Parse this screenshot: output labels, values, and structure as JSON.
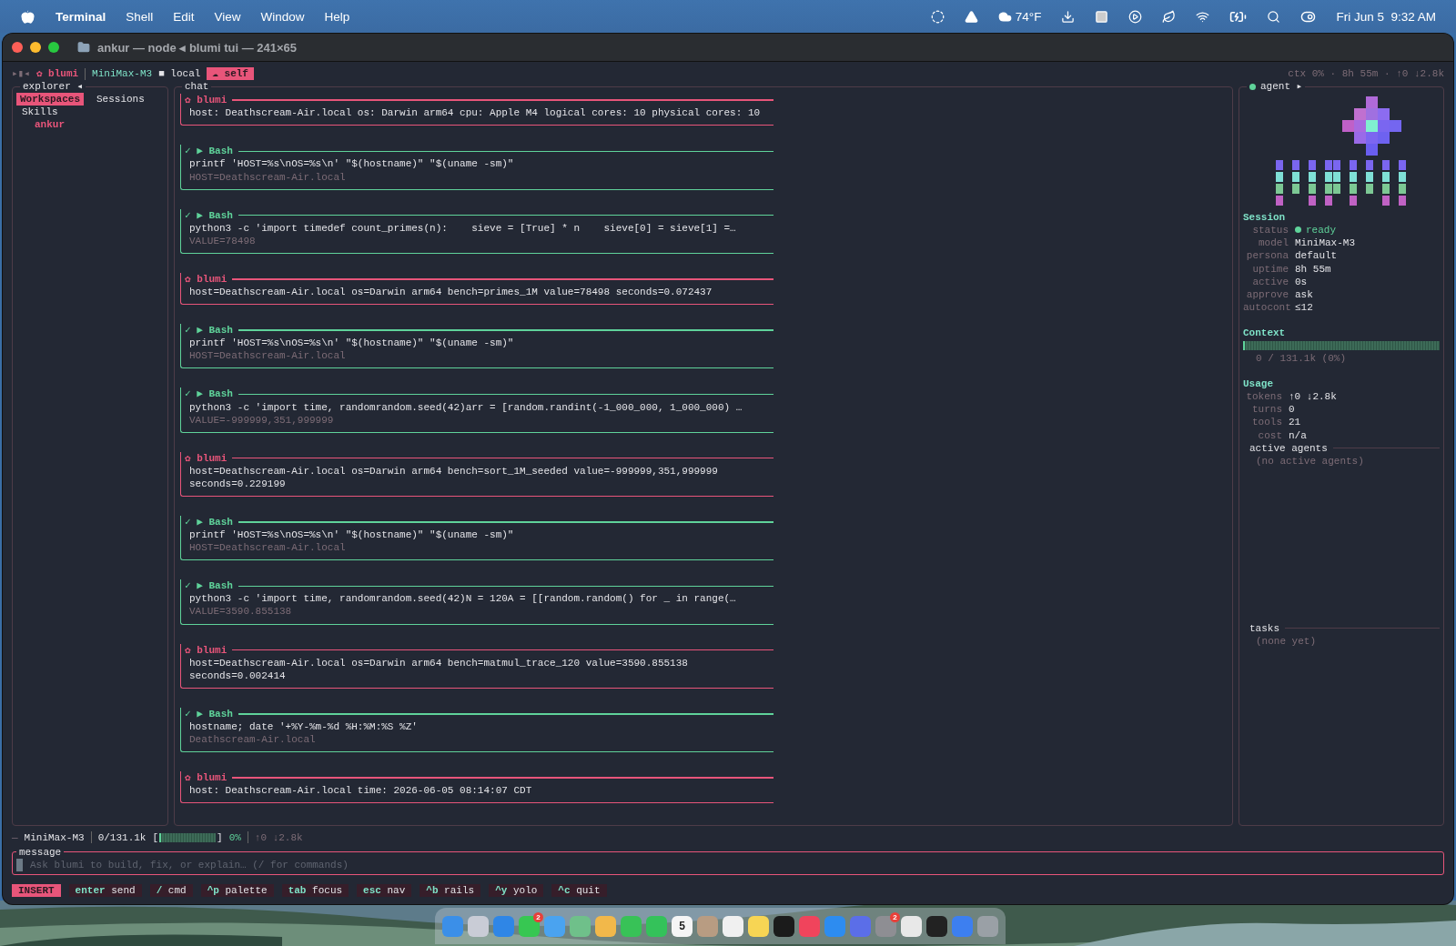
{
  "menubar": {
    "app": "Terminal",
    "menus": [
      "Shell",
      "Edit",
      "View",
      "Window",
      "Help"
    ],
    "weather": "74°F",
    "clock": "Fri Jun 5  9:32 AM"
  },
  "window": {
    "title": "ankur — node ◂ blumi tui — 241×65"
  },
  "header": {
    "nav": "▸▮◂",
    "brand": "✿ blumi",
    "model": "MiniMax-M3",
    "mode": "■ local",
    "badge": "☁ self",
    "summary": "ctx 0% · 8h 55m · ↑0 ↓2.8k"
  },
  "explorer": {
    "title": "explorer ◂",
    "tabs": [
      {
        "label": "Workspaces",
        "selected": true
      },
      {
        "label": "Sessions",
        "selected": false
      }
    ],
    "items": [
      {
        "label": "Skills",
        "selected": false,
        "children": [
          {
            "label": "ankur",
            "selected": true
          }
        ]
      }
    ]
  },
  "chat": {
    "title": "chat",
    "messages": [
      {
        "kind": "agent",
        "title": "✿ blumi",
        "lines": [
          "host: Deathscream-Air.local os: Darwin arm64 cpu: Apple M4 logical cores: 10 physical cores: 10"
        ]
      },
      {
        "kind": "tool",
        "title": "✓ ▶ Bash",
        "command": "printf 'HOST=%s\\nOS=%s\\n' \"$(hostname)\" \"$(uname -sm)\"",
        "output": "HOST=Deathscream-Air.local"
      },
      {
        "kind": "tool",
        "title": "✓ ▶ Bash",
        "command": "python3 -c 'import timedef count_primes(n):    sieve = [True] * n    sieve[0] = sieve[1] =…",
        "output": "VALUE=78498"
      },
      {
        "kind": "agent",
        "title": "✿ blumi",
        "lines": [
          "host=Deathscream-Air.local os=Darwin arm64 bench=primes_1M value=78498 seconds=0.072437"
        ]
      },
      {
        "kind": "tool",
        "title": "✓ ▶ Bash",
        "command": "printf 'HOST=%s\\nOS=%s\\n' \"$(hostname)\" \"$(uname -sm)\"",
        "output": "HOST=Deathscream-Air.local"
      },
      {
        "kind": "tool",
        "title": "✓ ▶ Bash",
        "command": "python3 -c 'import time, randomrandom.seed(42)arr = [random.randint(-1_000_000, 1_000_000) …",
        "output": "VALUE=-999999,351,999999"
      },
      {
        "kind": "agent",
        "title": "✿ blumi",
        "lines": [
          "host=Deathscream-Air.local os=Darwin arm64 bench=sort_1M_seeded value=-999999,351,999999",
          "seconds=0.229199"
        ]
      },
      {
        "kind": "tool",
        "title": "✓ ▶ Bash",
        "command": "printf 'HOST=%s\\nOS=%s\\n' \"$(hostname)\" \"$(uname -sm)\"",
        "output": "HOST=Deathscream-Air.local"
      },
      {
        "kind": "tool",
        "title": "✓ ▶ Bash",
        "command": "python3 -c 'import time, randomrandom.seed(42)N = 120A = [[random.random() for _ in range(…",
        "output": "VALUE=3590.855138"
      },
      {
        "kind": "agent",
        "title": "✿ blumi",
        "lines": [
          "host=Deathscream-Air.local os=Darwin arm64 bench=matmul_trace_120 value=3590.855138",
          "seconds=0.002414"
        ]
      },
      {
        "kind": "tool",
        "title": "✓ ▶ Bash",
        "command": "hostname; date '+%Y-%m-%d %H:%M:%S %Z'",
        "output": "Deathscream-Air.local"
      },
      {
        "kind": "agent",
        "title": "✿ blumi",
        "lines": [
          "host: Deathscream-Air.local time: 2026-06-05 08:14:07 CDT"
        ]
      }
    ]
  },
  "agent": {
    "title": "agent ▸",
    "session": {
      "heading": "Session",
      "rows": [
        {
          "label": "status",
          "value": "ready",
          "kind": "status"
        },
        {
          "label": "model",
          "value": "MiniMax-M3",
          "kind": "text"
        },
        {
          "label": "persona",
          "value": "default",
          "kind": "text"
        },
        {
          "label": "uptime",
          "value": "8h 55m",
          "kind": "text"
        },
        {
          "label": "active",
          "value": "0s",
          "kind": "text"
        },
        {
          "label": "approve",
          "value": "ask",
          "kind": "text"
        },
        {
          "label": "autocont",
          "value": "≤12",
          "kind": "text"
        }
      ]
    },
    "context": {
      "heading": "Context",
      "level": 0,
      "reading": "0 / 131.1k (0%)"
    },
    "usage": {
      "heading": "Usage",
      "rows": [
        {
          "label": "tokens",
          "value": "↑0 ↓2.8k"
        },
        {
          "label": "turns",
          "value": "0"
        },
        {
          "label": "tools",
          "value": "21"
        },
        {
          "label": "cost",
          "value": "n/a"
        }
      ]
    },
    "agents": {
      "title": "active agents",
      "empty": "(no active agents)"
    },
    "tasks": {
      "title": "tasks",
      "empty": "(none yet)"
    }
  },
  "status_bar": {
    "lead": "—",
    "model": "MiniMax-M3",
    "meter_open": "[",
    "meter_close": "]",
    "tokens": "0/131.1k",
    "level": 0,
    "percent": "0%",
    "io": "↑0 ↓2.8k"
  },
  "message": {
    "label": "message",
    "placeholder": "Ask blumi to build, fix, or explain… (/ for commands)"
  },
  "keybar": {
    "mode": "INSERT",
    "keys": [
      {
        "key": "enter",
        "action": "send"
      },
      {
        "key": "/",
        "action": "cmd"
      },
      {
        "key": "^p",
        "action": "palette"
      },
      {
        "key": "tab",
        "action": "focus"
      },
      {
        "key": "esc",
        "action": "nav"
      },
      {
        "key": "^b",
        "action": "rails"
      },
      {
        "key": "^y",
        "action": "yolo"
      },
      {
        "key": "^c",
        "action": "quit"
      }
    ]
  },
  "dock": [
    {
      "color": "#3b8fe8"
    },
    {
      "color": "#c9ccd6"
    },
    {
      "color": "#2f86e6"
    },
    {
      "color": "#37c752",
      "badge": "2"
    },
    {
      "color": "#4aa3f0"
    },
    {
      "color": "#6fc08a"
    },
    {
      "color": "#f2b84a"
    },
    {
      "color": "#38c257"
    },
    {
      "color": "#34c25a"
    },
    {
      "color": "#f5f5f5",
      "day": "5"
    },
    {
      "color": "#b89c82"
    },
    {
      "color": "#f0f0f0"
    },
    {
      "color": "#f7d554"
    },
    {
      "color": "#1b1b1b"
    },
    {
      "color": "#f0445c"
    },
    {
      "color": "#2d8cf0"
    },
    {
      "color": "#5b6ee8"
    },
    {
      "color": "#8e8e93",
      "badge": "2"
    },
    {
      "color": "#e8e8e8"
    },
    {
      "color": "#222222"
    },
    {
      "color": "#3d7ff0"
    },
    {
      "color": "#9aa0a6"
    }
  ]
}
